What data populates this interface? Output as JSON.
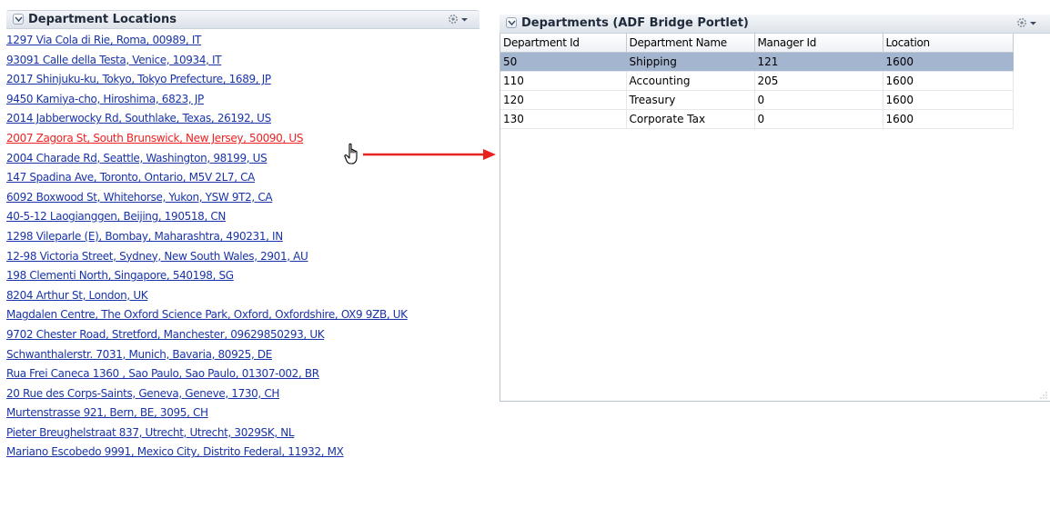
{
  "left_portlet": {
    "title": "Department Locations",
    "collapse_icon": "chevron-down-icon",
    "menu_icon": "gear-icon",
    "locations": [
      "1297 Via Cola di Rie, Roma, 00989, IT",
      "93091 Calle della Testa, Venice, 10934, IT",
      "2017 Shinjuku-ku, Tokyo, Tokyo Prefecture, 1689, JP",
      "9450 Kamiya-cho, Hiroshima, 6823, JP",
      "2014 Jabberwocky Rd, Southlake, Texas, 26192, US",
      "2007 Zagora St, South Brunswick, New Jersey, 50090, US",
      "2004 Charade Rd, Seattle, Washington, 98199, US",
      "147 Spadina Ave, Toronto, Ontario, M5V 2L7, CA",
      "6092 Boxwood St, Whitehorse, Yukon, YSW 9T2, CA",
      "40-5-12 Laogianggen, Beijing, 190518, CN",
      "1298 Vileparle (E), Bombay, Maharashtra, 490231, IN",
      "12-98 Victoria Street, Sydney, New South Wales, 2901, AU",
      "198 Clementi North, Singapore, 540198, SG",
      "8204 Arthur St, London, UK",
      "Magdalen Centre, The Oxford Science Park, Oxford, Oxfordshire, OX9 9ZB, UK",
      "9702 Chester Road, Stretford, Manchester, 09629850293, UK",
      "Schwanthalerstr. 7031, Munich, Bavaria, 80925, DE",
      "Rua Frei Caneca 1360 , Sao Paulo, Sao Paulo, 01307-002, BR",
      "20 Rue des Corps-Saints, Geneva, Geneve, 1730, CH",
      "Murtenstrasse 921, Bern, BE, 3095, CH",
      "Pieter Breughelstraat 837, Utrecht, Utrecht, 3029SK, NL",
      "Mariano Escobedo 9991, Mexico City, Distrito Federal, 11932, MX"
    ],
    "active_index": 5
  },
  "right_portlet": {
    "title": "Departments (ADF Bridge Portlet)",
    "collapse_icon": "chevron-down-icon",
    "menu_icon": "gear-icon",
    "columns": [
      "Department Id",
      "Department Name",
      "Manager Id",
      "Location"
    ],
    "rows": [
      [
        "50",
        "Shipping",
        "121",
        "1600"
      ],
      [
        "110",
        "Accounting",
        "205",
        "1600"
      ],
      [
        "120",
        "Treasury",
        "0",
        "1600"
      ],
      [
        "130",
        "Corporate Tax",
        "0",
        "1600"
      ]
    ],
    "selected_row": 0
  },
  "annotation": {
    "arrow_icon": "red-arrow-icon",
    "cursor_icon": "hand-pointer-icon",
    "arrow_color": "#e8231f"
  },
  "colors": {
    "link": "#1a34a7",
    "link_active": "#ee2222",
    "selected_row": "#a4b5cf"
  }
}
